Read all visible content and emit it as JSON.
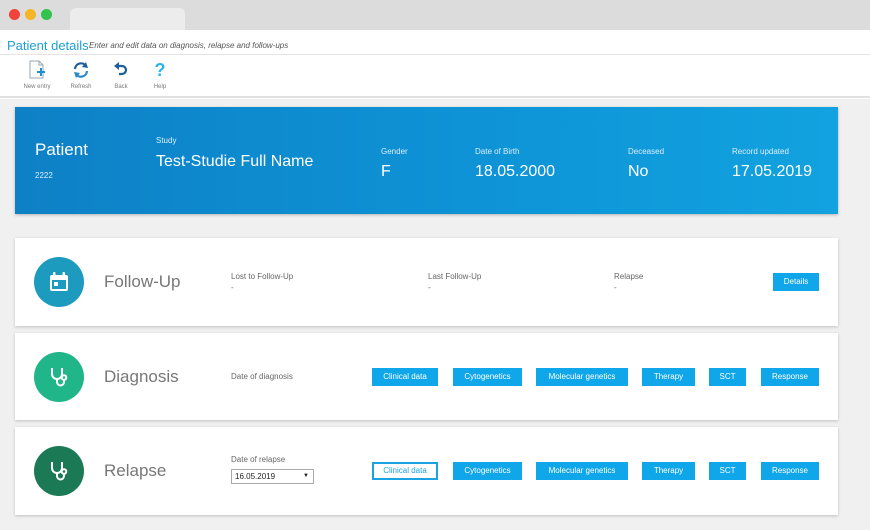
{
  "title": {
    "main": "Patient details",
    "subtitle": "Enter and edit data on diagnosis, relapse and follow-ups"
  },
  "toolbar": {
    "new_entry": "New entry",
    "refresh": "Refresh",
    "back": "Back",
    "help": "Help"
  },
  "patient": {
    "heading": "Patient",
    "id": "2222",
    "study_label": "Study",
    "study_value": "Test-Studie Full Name",
    "gender_label": "Gender",
    "gender_value": "F",
    "dob_label": "Date of Birth",
    "dob_value": "18.05.2000",
    "deceased_label": "Deceased",
    "deceased_value": "No",
    "updated_label": "Record updated",
    "updated_value": "17.05.2019"
  },
  "followup": {
    "title": "Follow-Up",
    "lost_label": "Lost to Follow-Up",
    "lost_value": "-",
    "last_label": "Last Follow-Up",
    "last_value": "-",
    "relapse_label": "Relapse",
    "relapse_value": "-",
    "details_button": "Details"
  },
  "diagnosis": {
    "title": "Diagnosis",
    "date_label": "Date of diagnosis",
    "buttons": [
      "Clinical data",
      "Cytogenetics",
      "Molecular genetics",
      "Therapy",
      "SCT",
      "Response"
    ]
  },
  "relapse": {
    "title": "Relapse",
    "date_label": "Date of relapse",
    "selected_date": "16.05.2019",
    "buttons": [
      "Clinical data",
      "Cytogenetics",
      "Molecular genetics",
      "Therapy",
      "SCT",
      "Response"
    ]
  },
  "colors": {
    "accent": "#1e9fd8",
    "button": "#10a6ea",
    "followup_circle": "#1c9bbf",
    "diagnosis_circle": "#21b58a",
    "relapse_circle": "#1b7a55"
  },
  "icons": {
    "followup": "calendar-icon",
    "diagnosis": "stethoscope-icon",
    "relapse": "stethoscope-icon"
  }
}
